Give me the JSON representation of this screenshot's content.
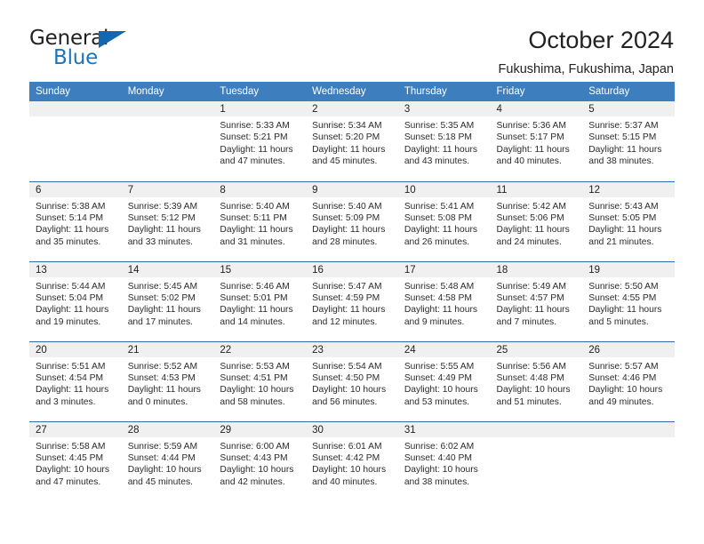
{
  "brand": {
    "name_part1": "General",
    "name_part2": "Blue",
    "triangle_color": "#1267b2",
    "blue_text_color": "#1b75bb"
  },
  "header": {
    "title": "October 2024",
    "subtitle": "Fukushima, Fukushima, Japan"
  },
  "theme": {
    "header_bg": "#3d7ebf",
    "header_text": "#ffffff",
    "daynum_band_bg": "#f0f0f0",
    "week_divider": "#2f6ba8",
    "page_bg": "#ffffff",
    "body_text": "#222222"
  },
  "weekday_headers": [
    "Sunday",
    "Monday",
    "Tuesday",
    "Wednesday",
    "Thursday",
    "Friday",
    "Saturday"
  ],
  "labels": {
    "sunrise_prefix": "Sunrise:",
    "sunset_prefix": "Sunset:",
    "daylight_prefix": "Daylight:"
  },
  "weeks": [
    [
      {
        "empty": true
      },
      {
        "empty": true
      },
      {
        "day": "1",
        "sunrise": "Sunrise: 5:33 AM",
        "sunset": "Sunset: 5:21 PM",
        "daylight1": "Daylight: 11 hours",
        "daylight2": "and 47 minutes."
      },
      {
        "day": "2",
        "sunrise": "Sunrise: 5:34 AM",
        "sunset": "Sunset: 5:20 PM",
        "daylight1": "Daylight: 11 hours",
        "daylight2": "and 45 minutes."
      },
      {
        "day": "3",
        "sunrise": "Sunrise: 5:35 AM",
        "sunset": "Sunset: 5:18 PM",
        "daylight1": "Daylight: 11 hours",
        "daylight2": "and 43 minutes."
      },
      {
        "day": "4",
        "sunrise": "Sunrise: 5:36 AM",
        "sunset": "Sunset: 5:17 PM",
        "daylight1": "Daylight: 11 hours",
        "daylight2": "and 40 minutes."
      },
      {
        "day": "5",
        "sunrise": "Sunrise: 5:37 AM",
        "sunset": "Sunset: 5:15 PM",
        "daylight1": "Daylight: 11 hours",
        "daylight2": "and 38 minutes."
      }
    ],
    [
      {
        "day": "6",
        "sunrise": "Sunrise: 5:38 AM",
        "sunset": "Sunset: 5:14 PM",
        "daylight1": "Daylight: 11 hours",
        "daylight2": "and 35 minutes."
      },
      {
        "day": "7",
        "sunrise": "Sunrise: 5:39 AM",
        "sunset": "Sunset: 5:12 PM",
        "daylight1": "Daylight: 11 hours",
        "daylight2": "and 33 minutes."
      },
      {
        "day": "8",
        "sunrise": "Sunrise: 5:40 AM",
        "sunset": "Sunset: 5:11 PM",
        "daylight1": "Daylight: 11 hours",
        "daylight2": "and 31 minutes."
      },
      {
        "day": "9",
        "sunrise": "Sunrise: 5:40 AM",
        "sunset": "Sunset: 5:09 PM",
        "daylight1": "Daylight: 11 hours",
        "daylight2": "and 28 minutes."
      },
      {
        "day": "10",
        "sunrise": "Sunrise: 5:41 AM",
        "sunset": "Sunset: 5:08 PM",
        "daylight1": "Daylight: 11 hours",
        "daylight2": "and 26 minutes."
      },
      {
        "day": "11",
        "sunrise": "Sunrise: 5:42 AM",
        "sunset": "Sunset: 5:06 PM",
        "daylight1": "Daylight: 11 hours",
        "daylight2": "and 24 minutes."
      },
      {
        "day": "12",
        "sunrise": "Sunrise: 5:43 AM",
        "sunset": "Sunset: 5:05 PM",
        "daylight1": "Daylight: 11 hours",
        "daylight2": "and 21 minutes."
      }
    ],
    [
      {
        "day": "13",
        "sunrise": "Sunrise: 5:44 AM",
        "sunset": "Sunset: 5:04 PM",
        "daylight1": "Daylight: 11 hours",
        "daylight2": "and 19 minutes."
      },
      {
        "day": "14",
        "sunrise": "Sunrise: 5:45 AM",
        "sunset": "Sunset: 5:02 PM",
        "daylight1": "Daylight: 11 hours",
        "daylight2": "and 17 minutes."
      },
      {
        "day": "15",
        "sunrise": "Sunrise: 5:46 AM",
        "sunset": "Sunset: 5:01 PM",
        "daylight1": "Daylight: 11 hours",
        "daylight2": "and 14 minutes."
      },
      {
        "day": "16",
        "sunrise": "Sunrise: 5:47 AM",
        "sunset": "Sunset: 4:59 PM",
        "daylight1": "Daylight: 11 hours",
        "daylight2": "and 12 minutes."
      },
      {
        "day": "17",
        "sunrise": "Sunrise: 5:48 AM",
        "sunset": "Sunset: 4:58 PM",
        "daylight1": "Daylight: 11 hours",
        "daylight2": "and 9 minutes."
      },
      {
        "day": "18",
        "sunrise": "Sunrise: 5:49 AM",
        "sunset": "Sunset: 4:57 PM",
        "daylight1": "Daylight: 11 hours",
        "daylight2": "and 7 minutes."
      },
      {
        "day": "19",
        "sunrise": "Sunrise: 5:50 AM",
        "sunset": "Sunset: 4:55 PM",
        "daylight1": "Daylight: 11 hours",
        "daylight2": "and 5 minutes."
      }
    ],
    [
      {
        "day": "20",
        "sunrise": "Sunrise: 5:51 AM",
        "sunset": "Sunset: 4:54 PM",
        "daylight1": "Daylight: 11 hours",
        "daylight2": "and 3 minutes."
      },
      {
        "day": "21",
        "sunrise": "Sunrise: 5:52 AM",
        "sunset": "Sunset: 4:53 PM",
        "daylight1": "Daylight: 11 hours",
        "daylight2": "and 0 minutes."
      },
      {
        "day": "22",
        "sunrise": "Sunrise: 5:53 AM",
        "sunset": "Sunset: 4:51 PM",
        "daylight1": "Daylight: 10 hours",
        "daylight2": "and 58 minutes."
      },
      {
        "day": "23",
        "sunrise": "Sunrise: 5:54 AM",
        "sunset": "Sunset: 4:50 PM",
        "daylight1": "Daylight: 10 hours",
        "daylight2": "and 56 minutes."
      },
      {
        "day": "24",
        "sunrise": "Sunrise: 5:55 AM",
        "sunset": "Sunset: 4:49 PM",
        "daylight1": "Daylight: 10 hours",
        "daylight2": "and 53 minutes."
      },
      {
        "day": "25",
        "sunrise": "Sunrise: 5:56 AM",
        "sunset": "Sunset: 4:48 PM",
        "daylight1": "Daylight: 10 hours",
        "daylight2": "and 51 minutes."
      },
      {
        "day": "26",
        "sunrise": "Sunrise: 5:57 AM",
        "sunset": "Sunset: 4:46 PM",
        "daylight1": "Daylight: 10 hours",
        "daylight2": "and 49 minutes."
      }
    ],
    [
      {
        "day": "27",
        "sunrise": "Sunrise: 5:58 AM",
        "sunset": "Sunset: 4:45 PM",
        "daylight1": "Daylight: 10 hours",
        "daylight2": "and 47 minutes."
      },
      {
        "day": "28",
        "sunrise": "Sunrise: 5:59 AM",
        "sunset": "Sunset: 4:44 PM",
        "daylight1": "Daylight: 10 hours",
        "daylight2": "and 45 minutes."
      },
      {
        "day": "29",
        "sunrise": "Sunrise: 6:00 AM",
        "sunset": "Sunset: 4:43 PM",
        "daylight1": "Daylight: 10 hours",
        "daylight2": "and 42 minutes."
      },
      {
        "day": "30",
        "sunrise": "Sunrise: 6:01 AM",
        "sunset": "Sunset: 4:42 PM",
        "daylight1": "Daylight: 10 hours",
        "daylight2": "and 40 minutes."
      },
      {
        "day": "31",
        "sunrise": "Sunrise: 6:02 AM",
        "sunset": "Sunset: 4:40 PM",
        "daylight1": "Daylight: 10 hours",
        "daylight2": "and 38 minutes."
      },
      {
        "empty": true
      },
      {
        "empty": true
      }
    ]
  ]
}
